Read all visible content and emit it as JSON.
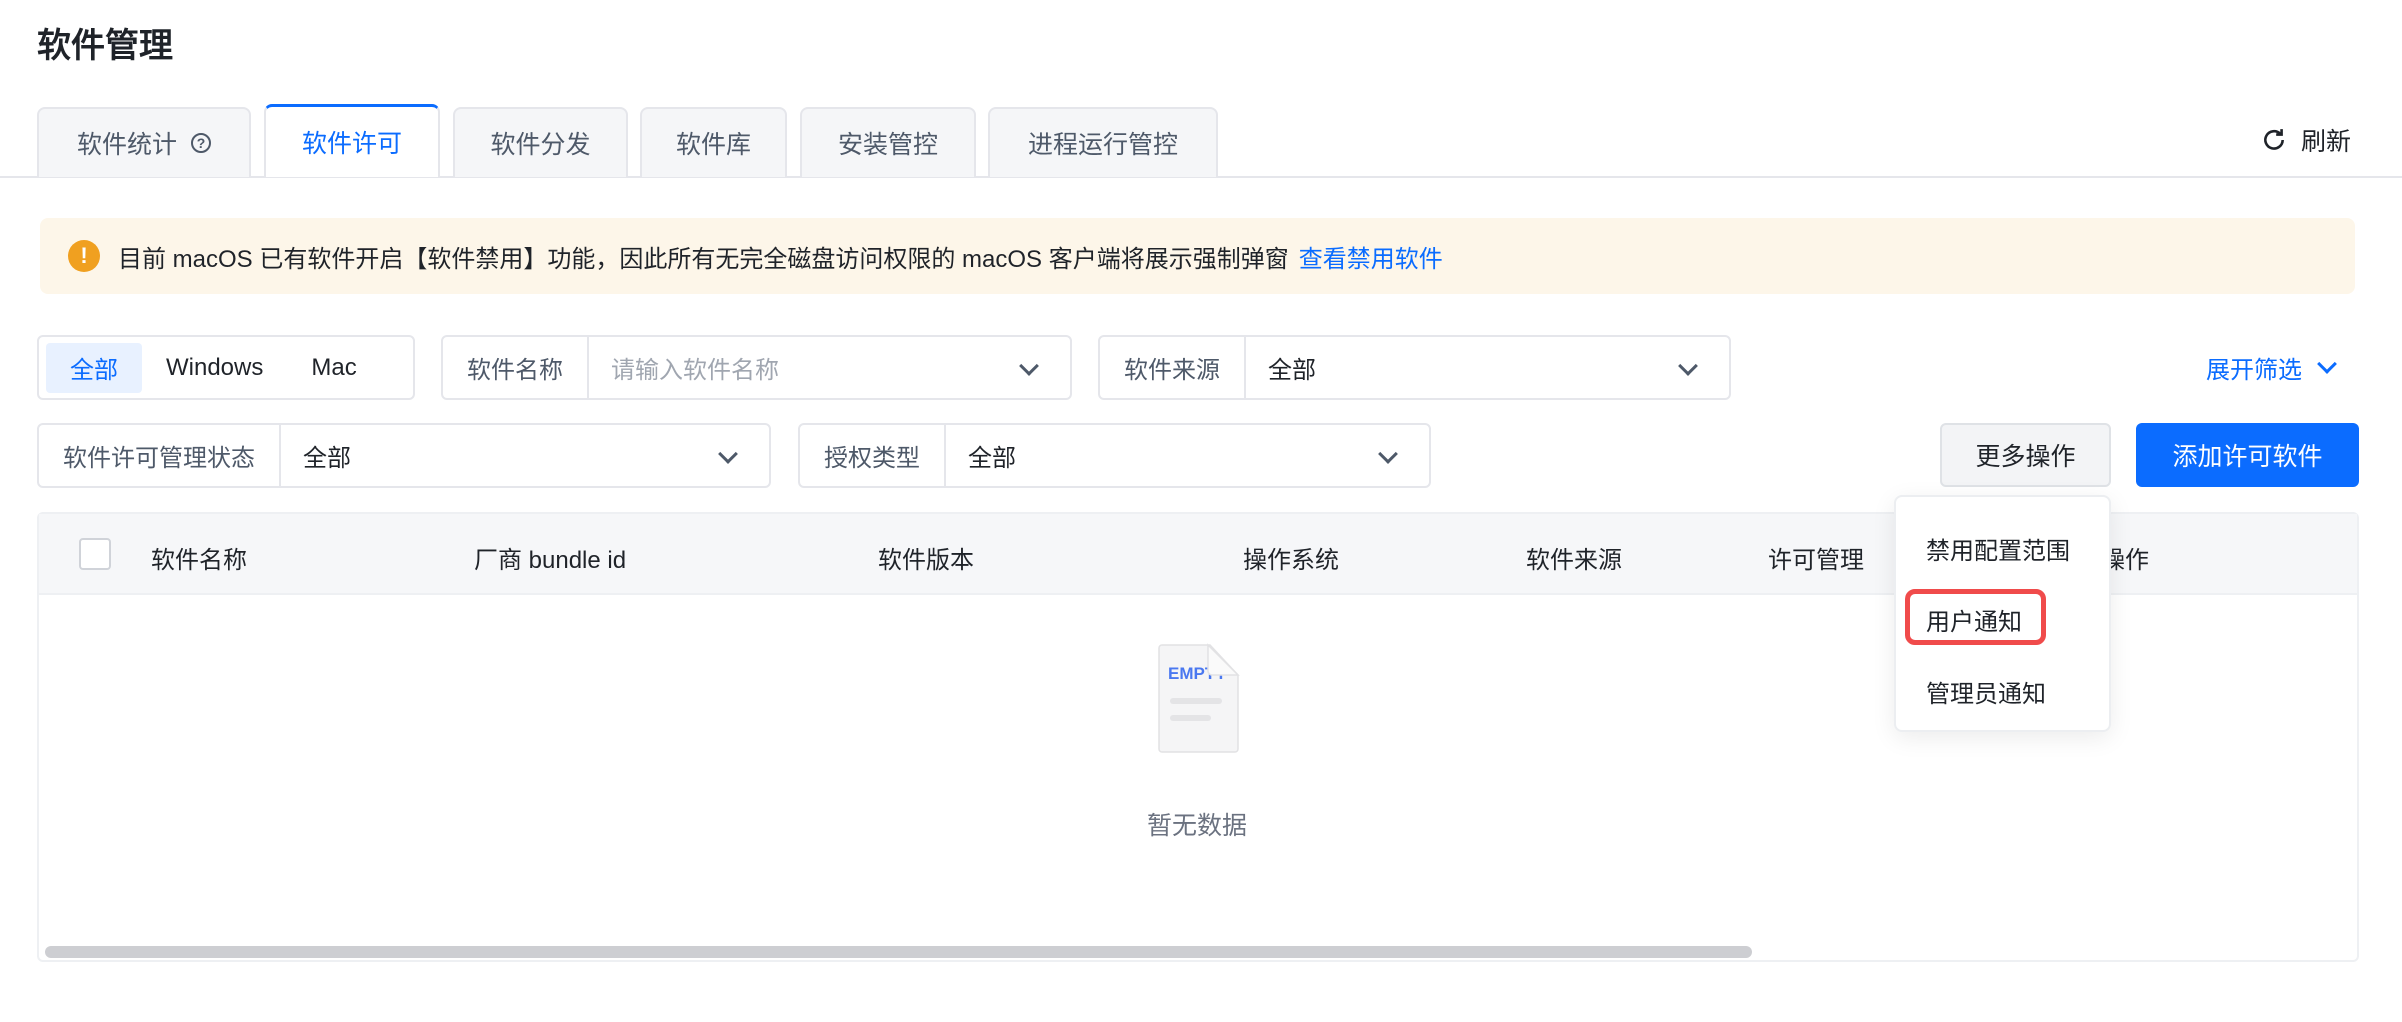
{
  "page_title": "软件管理",
  "tabs": [
    {
      "label": "软件统计",
      "help_icon": "question-circle-icon"
    },
    {
      "label": "软件许可",
      "active": true
    },
    {
      "label": "软件分发"
    },
    {
      "label": "软件库"
    },
    {
      "label": "安装管控"
    },
    {
      "label": "进程运行管控"
    }
  ],
  "refresh": {
    "label": "刷新",
    "icon": "refresh-icon"
  },
  "alert": {
    "icon": "warning-icon",
    "text": "目前 macOS 已有软件开启【软件禁用】功能，因此所有无完全磁盘访问权限的 macOS 客户端将展示强制弹窗",
    "link": "查看禁用软件"
  },
  "filters": {
    "os_segment": [
      "全部",
      "Windows",
      "Mac"
    ],
    "software_name": {
      "label": "软件名称",
      "placeholder": "请输入软件名称"
    },
    "software_source": {
      "label": "软件来源",
      "value": "全部"
    },
    "expand_label": "展开筛选",
    "license_status": {
      "label": "软件许可管理状态",
      "value": "全部"
    },
    "auth_type": {
      "label": "授权类型",
      "value": "全部"
    }
  },
  "actions": {
    "more": "更多操作",
    "add": "添加许可软件"
  },
  "more_menu": [
    "禁用配置范围",
    "用户通知",
    "管理员通知"
  ],
  "table": {
    "columns": [
      "软件名称",
      "厂商 bundle id",
      "软件版本",
      "操作系统",
      "软件来源",
      "许可管理",
      "操作"
    ],
    "empty_icon_text": "EMPTY",
    "empty_text": "暂无数据"
  },
  "colors": {
    "primary": "#0b6cff",
    "warning": "#f0a020",
    "alert_bg": "#fdf6e9",
    "highlight": "#f04b4b"
  }
}
